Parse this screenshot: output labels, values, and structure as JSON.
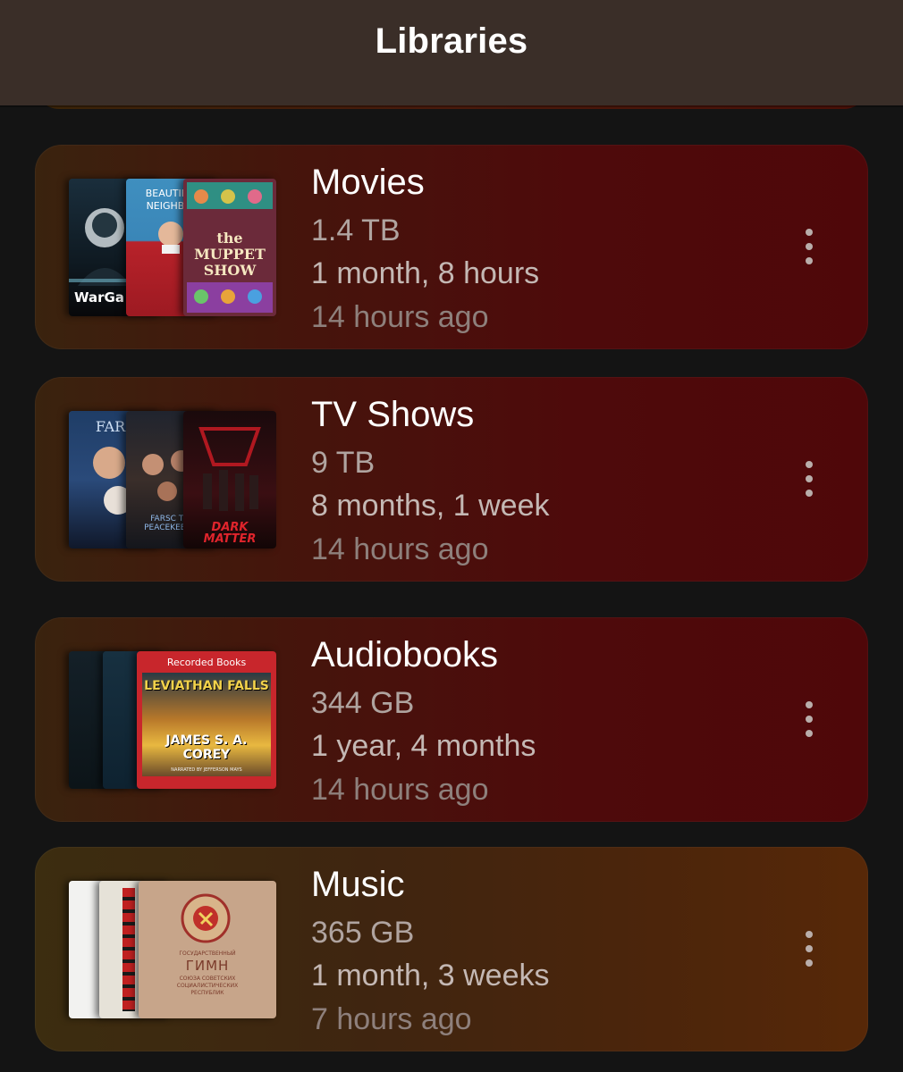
{
  "header": {
    "title": "Libraries"
  },
  "libraries": [
    {
      "name": "Movies",
      "size": "1.4 TB",
      "duration": "1 month, 8 hours",
      "updated": "14 hours ago",
      "covers": [
        "WarGa",
        "BEAUTIFUL NEIGHBOR",
        "the MUPPET SHOW"
      ]
    },
    {
      "name": "TV Shows",
      "size": "9 TB",
      "duration": "8 months, 1 week",
      "updated": "14 hours ago",
      "covers": [
        "FARS",
        "FARSC THE PEACEKEEPER",
        "DARK MATTER"
      ]
    },
    {
      "name": "Audiobooks",
      "size": "344 GB",
      "duration": "1 year, 4 months",
      "updated": "14 hours ago",
      "covers": [
        "Recorded Books",
        "LEVIATHAN FALLS",
        "JAMES S. A. COREY",
        "NARRATED BY JEFFERSON MAYS"
      ]
    },
    {
      "name": "Music",
      "size": "365 GB",
      "duration": "1 month, 3 weeks",
      "updated": "7 hours ago",
      "covers": [
        "ГОСУДАРСТВЕННЫЙ",
        "ГИМН",
        "СОЮЗА СОВЕТСКИХ СОЦИАЛИСТИЧЕСКИХ РЕСПУБЛИК"
      ]
    }
  ],
  "colors": {
    "header_bg": "#3a2e28",
    "page_bg": "#141414",
    "card_red": "#4e0a0b",
    "card_amber": "#572808"
  },
  "icons": {
    "menu": "more-vertical-icon"
  }
}
